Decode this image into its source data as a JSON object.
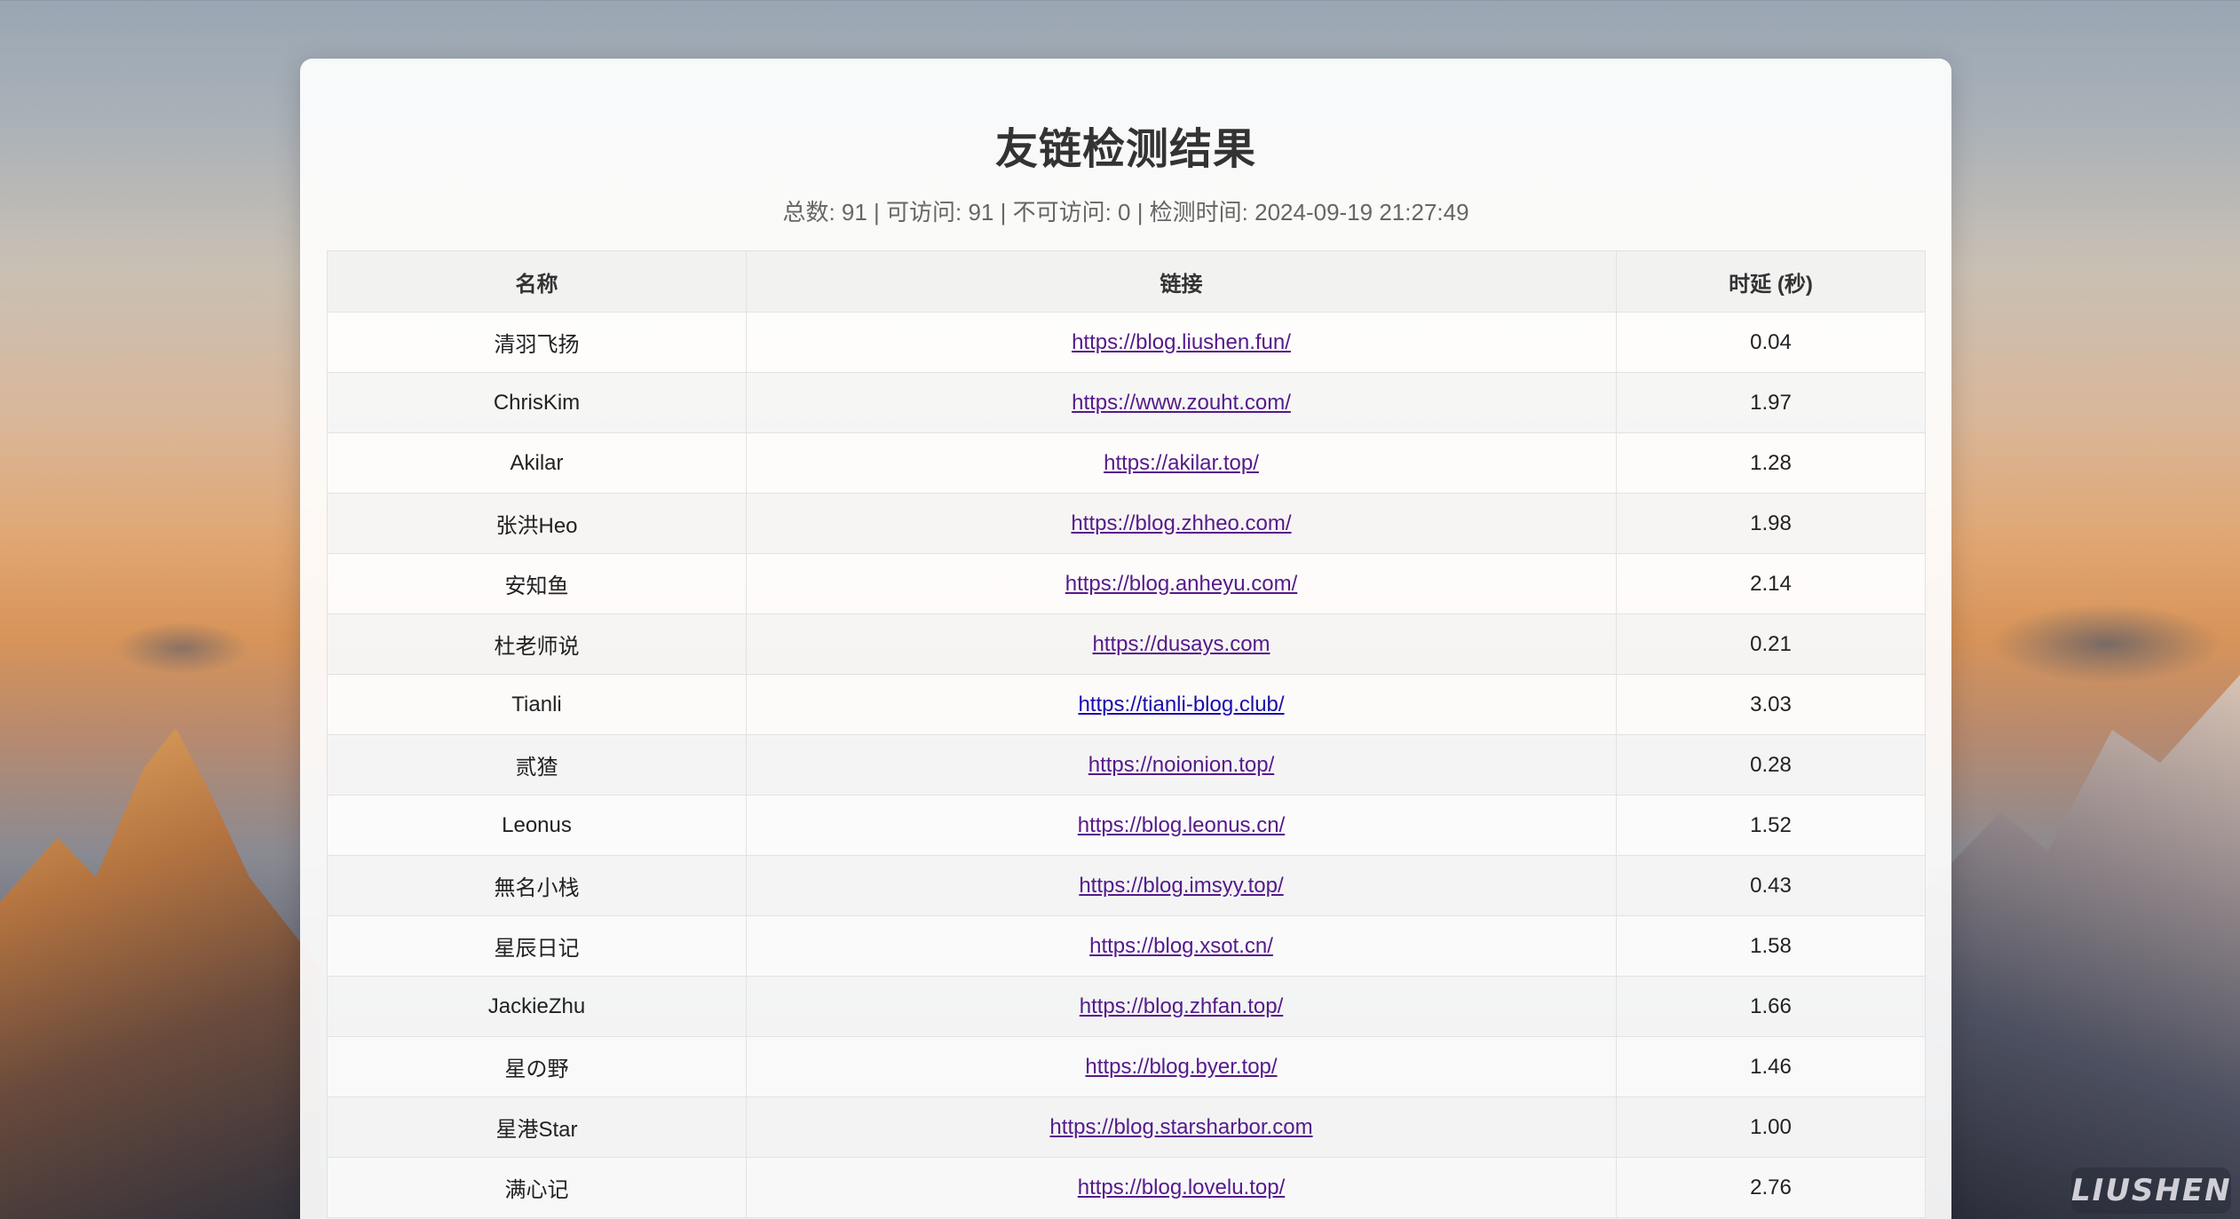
{
  "page": {
    "title": "友链检测结果",
    "summary": "总数: 91 | 可访问: 91 | 不可访问: 0 | 检测时间: 2024-09-19 21:27:49"
  },
  "table": {
    "headers": [
      "名称",
      "链接",
      "时延 (秒)"
    ],
    "rows": [
      {
        "name": "清羽飞扬",
        "url": "https://blog.liushen.fun/",
        "latency": "0.04"
      },
      {
        "name": "ChrisKim",
        "url": "https://www.zouht.com/",
        "latency": "1.97"
      },
      {
        "name": "Akilar",
        "url": "https://akilar.top/",
        "latency": "1.28"
      },
      {
        "name": "张洪Heo",
        "url": "https://blog.zhheo.com/",
        "latency": "1.98"
      },
      {
        "name": "安知鱼",
        "url": "https://blog.anheyu.com/",
        "latency": "2.14"
      },
      {
        "name": "杜老师说",
        "url": "https://dusays.com",
        "latency": "0.21"
      },
      {
        "name": "Tianli",
        "url": "https://tianli-blog.club/",
        "latency": "3.03"
      },
      {
        "name": "贰猹",
        "url": "https://noionion.top/",
        "latency": "0.28"
      },
      {
        "name": "Leonus",
        "url": "https://blog.leonus.cn/",
        "latency": "1.52"
      },
      {
        "name": "無名小栈",
        "url": "https://blog.imsyy.top/",
        "latency": "0.43"
      },
      {
        "name": "星辰日记",
        "url": "https://blog.xsot.cn/",
        "latency": "1.58"
      },
      {
        "name": "JackieZhu",
        "url": "https://blog.zhfan.top/",
        "latency": "1.66"
      },
      {
        "name": "星の野",
        "url": "https://blog.byer.top/",
        "latency": "1.46"
      },
      {
        "name": "星港Star",
        "url": "https://blog.starsharbor.com",
        "latency": "1.00"
      },
      {
        "name": "满心记",
        "url": "https://blog.lovelu.top/",
        "latency": "2.76"
      }
    ]
  },
  "watermark": {
    "text": "LIUSHEN"
  },
  "colors": {
    "visited_link": "#551a8b",
    "unvisited_link": "#1a0dab"
  }
}
